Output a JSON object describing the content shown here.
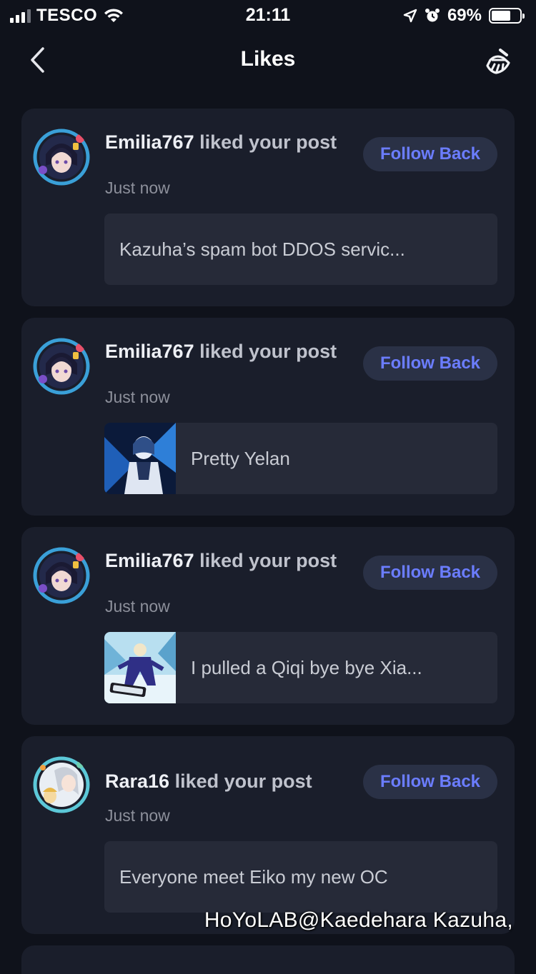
{
  "status_bar": {
    "carrier": "TESCO",
    "time": "21:11",
    "battery_percent": "69%",
    "battery_level": 0.69
  },
  "nav": {
    "title": "Likes",
    "back_icon": "chevron-left-icon",
    "clear_icon": "broom-icon"
  },
  "notifications": [
    {
      "username": "Emilia767",
      "action": " liked your post",
      "time": "Just now",
      "button": "Follow Back",
      "post_text": "Kazuha’s spam bot DDOS servic...",
      "has_thumbnail": false
    },
    {
      "username": "Emilia767",
      "action": " liked your post",
      "time": "Just now",
      "button": "Follow Back",
      "post_text": "Pretty Yelan",
      "has_thumbnail": true
    },
    {
      "username": "Emilia767",
      "action": " liked your post",
      "time": "Just now",
      "button": "Follow Back",
      "post_text": "I pulled a Qiqi bye bye Xia...",
      "has_thumbnail": true
    },
    {
      "username": "Rara16",
      "action": " liked your post",
      "time": "Just now",
      "button": "Follow Back",
      "post_text": "Everyone meet Eiko my new OC",
      "has_thumbnail": false
    }
  ],
  "watermark": "HoYoLAB@Kaedehara Kazuha,",
  "colors": {
    "background": "#0f121b",
    "card": "#1a1e2b",
    "accent": "#6b7dff",
    "button_bg": "#2a3146"
  }
}
